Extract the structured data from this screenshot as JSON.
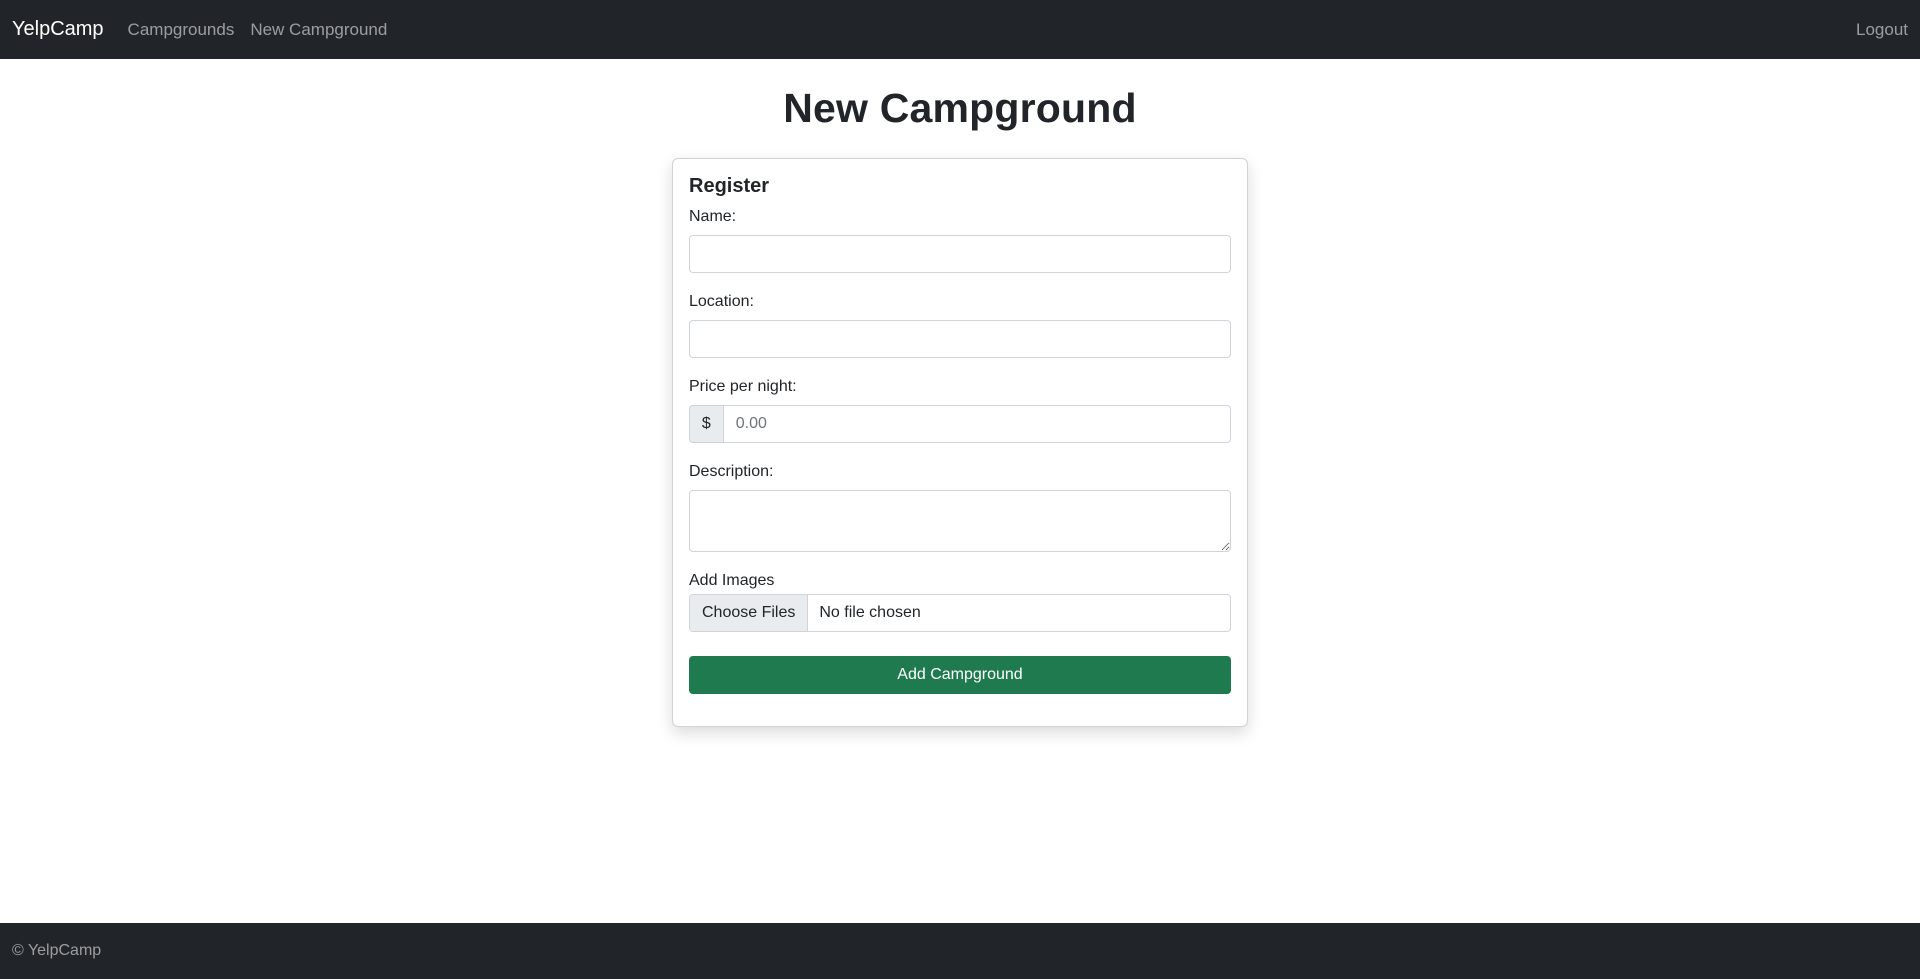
{
  "navbar": {
    "brand": "YelpCamp",
    "links": [
      {
        "label": "Campgrounds"
      },
      {
        "label": "New Campground"
      }
    ],
    "logout": "Logout"
  },
  "main": {
    "title": "New Campground",
    "card_title": "Register",
    "fields": {
      "name": {
        "label": "Name:",
        "value": ""
      },
      "location": {
        "label": "Location:",
        "value": ""
      },
      "price": {
        "label": "Price per night:",
        "prefix": "$",
        "placeholder": "0.00"
      },
      "description": {
        "label": "Description:",
        "value": ""
      },
      "images": {
        "label": "Add Images",
        "button": "Choose Files",
        "status": "No file chosen"
      }
    },
    "submit": "Add Campground"
  },
  "footer": {
    "text": "© YelpCamp"
  },
  "colors": {
    "navbar_bg": "#212529",
    "submit_bg": "#1f7b4f"
  }
}
